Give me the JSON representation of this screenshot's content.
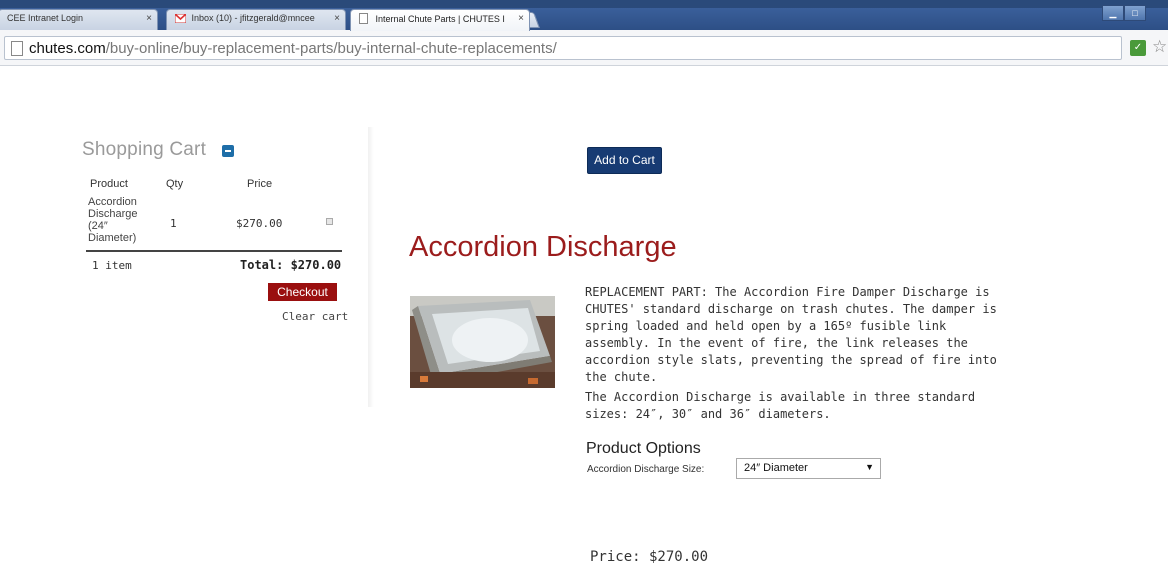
{
  "browser": {
    "tabs": [
      {
        "title": "CEE Intranet Login",
        "close": "×"
      },
      {
        "title": "Inbox (10) - jfitzgerald@mncee",
        "close": "×"
      },
      {
        "title": "Internal Chute Parts | CHUTES I",
        "close": "×"
      }
    ],
    "url_domain": "chutes.com",
    "url_path": "/buy-online/buy-replacement-parts/buy-internal-chute-replacements/"
  },
  "cart": {
    "title": "Shopping Cart",
    "headers": {
      "product": "Product",
      "qty": "Qty",
      "price": "Price"
    },
    "item": {
      "name": "Accordion Discharge (24″ Diameter)",
      "qty": "1",
      "price": "$270.00"
    },
    "count_label": "1 item",
    "total_label": "Total: $270.00",
    "checkout_label": "Checkout",
    "clear_label": "Clear cart"
  },
  "product": {
    "add_to_cart_label": "Add to Cart",
    "title": "Accordion Discharge",
    "description_1": "REPLACEMENT PART:  The Accordion Fire Damper Discharge is CHUTES' standard discharge on trash chutes.  The damper is spring loaded and held open by a 165º fusible link assembly.  In the event of fire, the link releases the accordion style slats, preventing the spread of fire into the chute.",
    "description_2": "The Accordion Discharge is available in three standard sizes: 24″, 30″ and 36″ diameters.",
    "options_title": "Product Options",
    "option_label": "Accordion Discharge Size:",
    "option_value": "24″ Diameter",
    "price_label": "Price: $270.00"
  }
}
